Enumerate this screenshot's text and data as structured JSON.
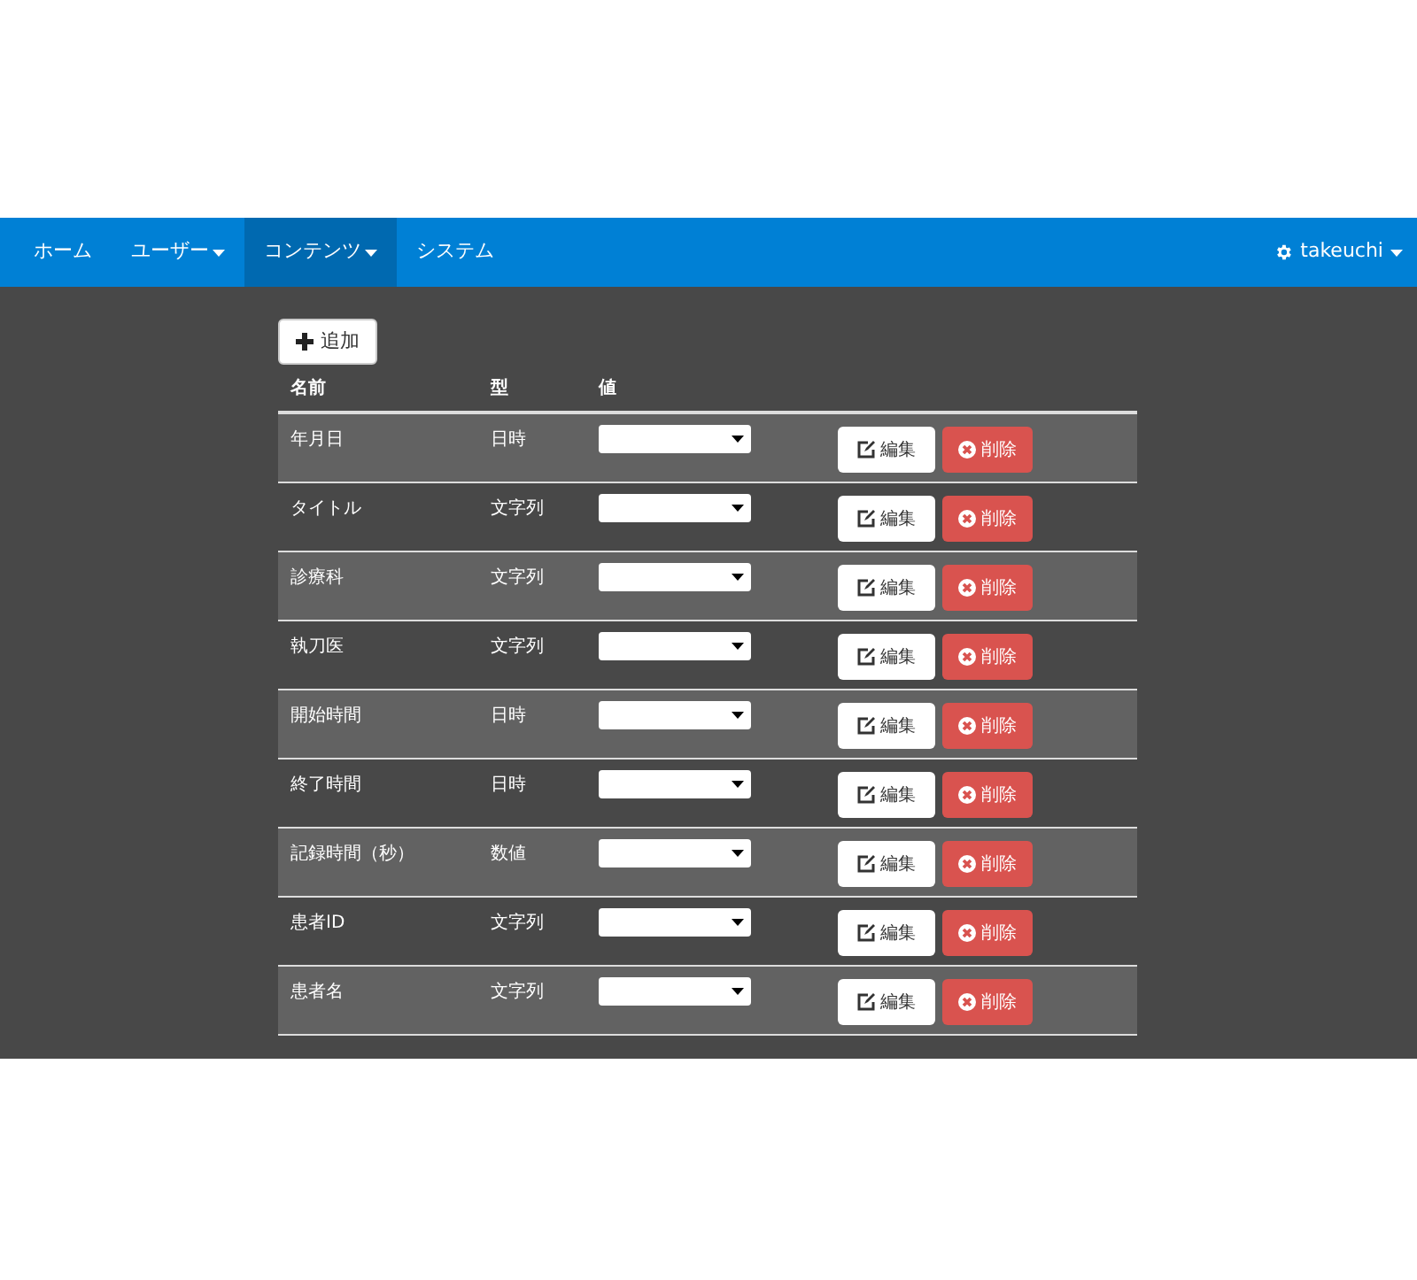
{
  "nav": {
    "items": [
      {
        "label": "ホーム",
        "dropdown": false,
        "selected": false
      },
      {
        "label": "ユーザー",
        "dropdown": true,
        "selected": false
      },
      {
        "label": "コンテンツ",
        "dropdown": true,
        "selected": true
      },
      {
        "label": "システム",
        "dropdown": false,
        "selected": false
      }
    ],
    "user": {
      "label": "takeuchi"
    }
  },
  "add_button": "追加",
  "table": {
    "columns": [
      "名前",
      "型",
      "値"
    ],
    "rows": [
      {
        "name": "年月日",
        "type": "日時",
        "edit": "編集",
        "delete": "削除"
      },
      {
        "name": "タイトル",
        "type": "文字列",
        "edit": "編集",
        "delete": "削除"
      },
      {
        "name": "診療科",
        "type": "文字列",
        "edit": "編集",
        "delete": "削除"
      },
      {
        "name": "執刀医",
        "type": "文字列",
        "edit": "編集",
        "delete": "削除"
      },
      {
        "name": "開始時間",
        "type": "日時",
        "edit": "編集",
        "delete": "削除"
      },
      {
        "name": "終了時間",
        "type": "日時",
        "edit": "編集",
        "delete": "削除"
      },
      {
        "name": "記録時間（秒）",
        "type": "数値",
        "edit": "編集",
        "delete": "削除"
      },
      {
        "name": "患者ID",
        "type": "文字列",
        "edit": "編集",
        "delete": "削除"
      },
      {
        "name": "患者名",
        "type": "文字列",
        "edit": "編集",
        "delete": "削除"
      }
    ]
  }
}
